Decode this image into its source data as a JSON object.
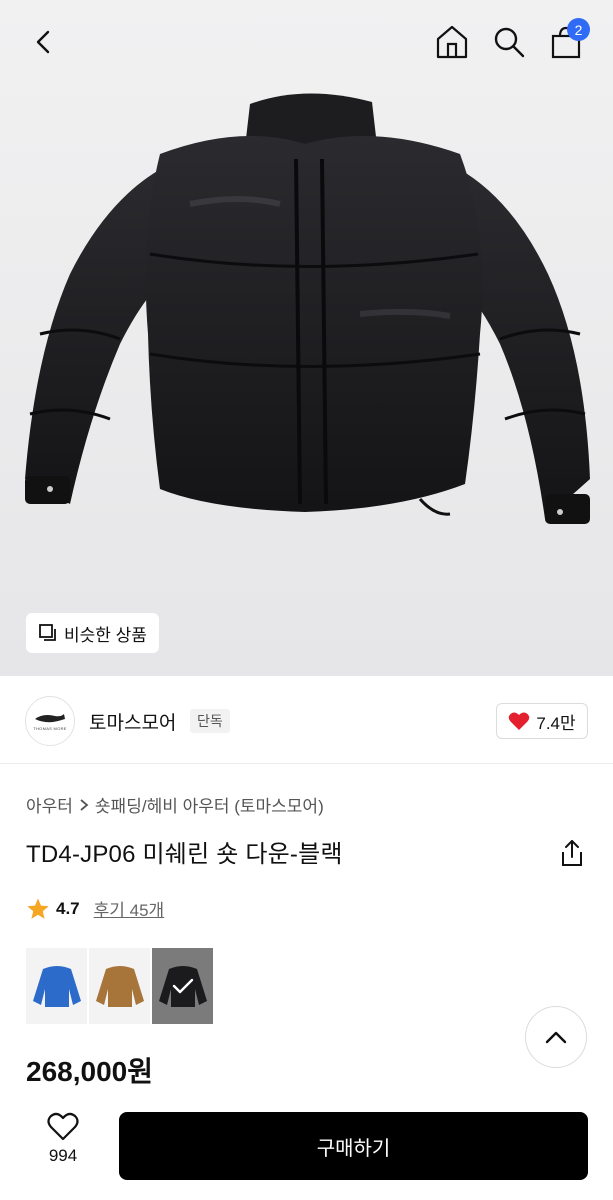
{
  "header": {
    "cart_badge": "2",
    "icons": [
      "chevron-left-icon",
      "home-icon",
      "search-icon",
      "bag-icon"
    ]
  },
  "gallery": {
    "similar_label": "비슷한 상품"
  },
  "seller": {
    "avatar_text": "THOMAS MORE",
    "name": "토마스모어",
    "tag": "단독",
    "likes": "7.4만"
  },
  "product": {
    "breadcrumb": [
      "아우터",
      "숏패딩/헤비 아우터 (토마스모어)"
    ],
    "title": "TD4-JP06 미쉐린 숏 다운-블랙",
    "rating": "4.7",
    "reviews": "후기 45개",
    "price": "268,000원",
    "colors": [
      {
        "name": "blue",
        "hex": "#2c6bc9",
        "selected": false
      },
      {
        "name": "brown",
        "hex": "#a7743a",
        "selected": false
      },
      {
        "name": "black",
        "hex": "#1b1b1d",
        "selected": true
      }
    ]
  },
  "bottom": {
    "wish_count": "994",
    "buy_label": "구매하기"
  },
  "colors": {
    "accent": "#2f6bf5",
    "heart": "#e5202e",
    "star": "#f5a623",
    "button": "#000000"
  }
}
